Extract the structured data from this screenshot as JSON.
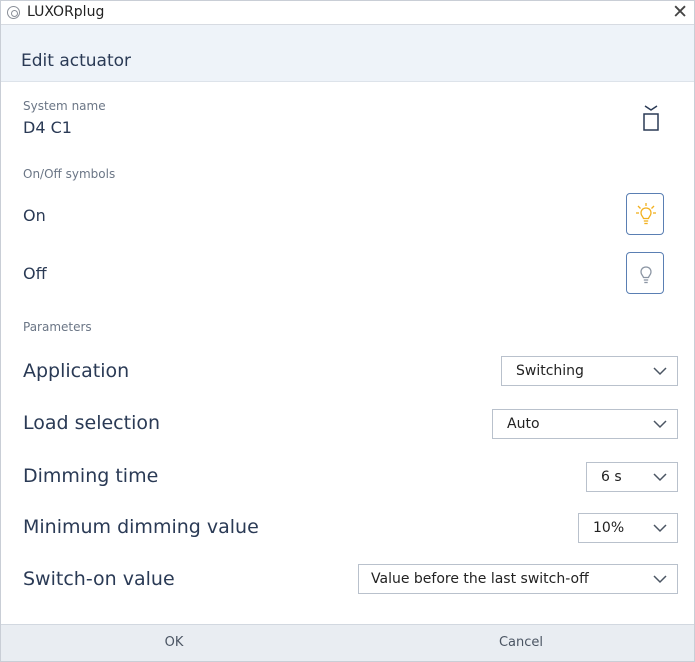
{
  "window": {
    "title": "LUXORplug"
  },
  "header": {
    "title": "Edit actuator"
  },
  "system": {
    "label": "System name",
    "value": "D4 C1"
  },
  "symbols": {
    "label": "On/Off symbols",
    "on_label": "On",
    "off_label": "Off",
    "on_icon": "lightbulb-on-icon",
    "off_icon": "lightbulb-off-icon",
    "on_color": "#f2b01e"
  },
  "parameters": {
    "label": "Parameters",
    "rows": [
      {
        "label": "Application",
        "value": "Switching"
      },
      {
        "label": "Load selection",
        "value": "Auto"
      },
      {
        "label": "Dimming time",
        "value": "6 s"
      },
      {
        "label": "Minimum dimming value",
        "value": "10%"
      },
      {
        "label": "Switch-on value",
        "value": "Value before the last switch-off"
      }
    ]
  },
  "footer": {
    "ok_label": "OK",
    "cancel_label": "Cancel"
  },
  "colors": {
    "header_bg": "#eef3f9",
    "accent_border": "#5a7fb3",
    "text": "#2a3a55"
  }
}
